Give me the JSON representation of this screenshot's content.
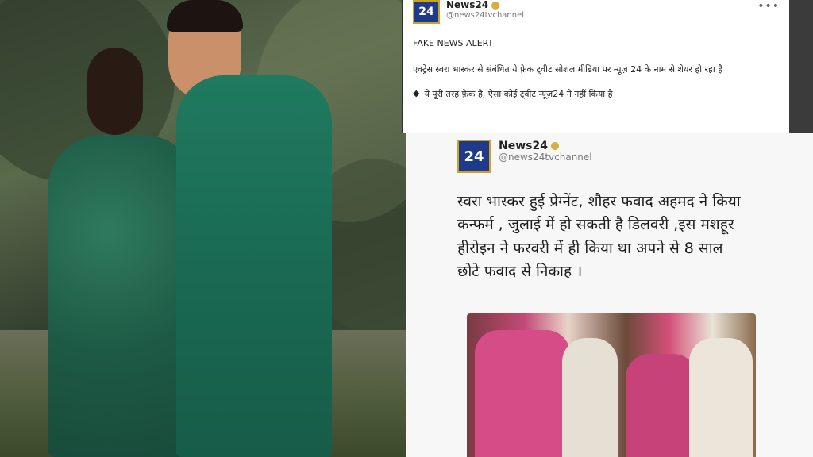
{
  "top_tweet": {
    "account_name": "News24",
    "account_handle": "@news24tvchannel",
    "logo_text": "24",
    "more_icon": "more-horizontal-icon",
    "alert_title": "FAKE NEWS ALERT",
    "alert_body": "एक्ट्रेस स्वरा भास्कर से संबंधित ये फ़ेक ट्वीट सोशल मीडिया पर न्यूज़ 24 के नाम से शेयर हो रहा है",
    "bullet_symbol": "◆",
    "bullet_text": "ये पूरी तरह फ़ेक है, ऐसा कोई ट्वीट न्यूज़24 ने नहीं किया है"
  },
  "bottom_tweet": {
    "account_name": "News24",
    "account_handle": "@news24tvchannel",
    "logo_text": "24",
    "body": "स्वरा भास्कर हुई प्रेग्नेंट, शौहर फवाद अहमद ने किया कन्फर्म , जुलाई में हो सकती है डिलवरी ,इस मशहूर हीरोइन ने फरवरी में ही किया था अपने से 8 साल छोटे फवाद से निकाह ।"
  },
  "colors": {
    "logo_bg": "#1f3a8a",
    "logo_border": "#c9a227",
    "verified_badge": "#d4b13a",
    "outfit_green": "#1f6b55"
  }
}
